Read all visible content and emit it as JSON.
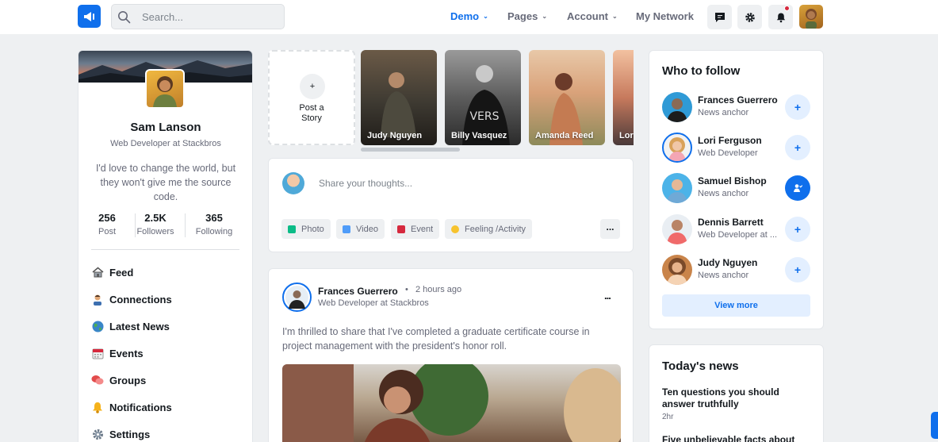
{
  "header": {
    "search_placeholder": "Search...",
    "nav": [
      "Demo",
      "Pages",
      "Account",
      "My Network"
    ]
  },
  "profile": {
    "name": "Sam Lanson",
    "title": "Web Developer at Stackbros",
    "bio": "I'd love to change the world, but they won't give me the source code.",
    "stats": [
      {
        "value": "256",
        "label": "Post"
      },
      {
        "value": "2.5K",
        "label": "Followers"
      },
      {
        "value": "365",
        "label": "Following"
      }
    ]
  },
  "menu": [
    {
      "label": "Feed",
      "icon": "home-icon"
    },
    {
      "label": "Connections",
      "icon": "person-icon"
    },
    {
      "label": "Latest News",
      "icon": "globe-icon"
    },
    {
      "label": "Events",
      "icon": "calendar-icon"
    },
    {
      "label": "Groups",
      "icon": "chat-icon"
    },
    {
      "label": "Notifications",
      "icon": "bell-icon"
    },
    {
      "label": "Settings",
      "icon": "gear-icon"
    }
  ],
  "stories": {
    "add_label_1": "Post a",
    "add_label_2": "Story",
    "items": [
      "Judy Nguyen",
      "Billy Vasquez",
      "Amanda Reed",
      "Lori"
    ]
  },
  "share": {
    "placeholder": "Share your thoughts...",
    "actions": [
      "Photo",
      "Video",
      "Event",
      "Feeling /Activity"
    ],
    "more": "..."
  },
  "post": {
    "author": "Frances Guerrero",
    "time": "2 hours ago",
    "role": "Web Developer at Stackbros",
    "text": "I'm thrilled to share that I've completed a graduate certificate course in project management with the president's honor roll.",
    "more": "..."
  },
  "who_to_follow": {
    "title": "Who to follow",
    "people": [
      {
        "name": "Frances Guerrero",
        "role": "News anchor"
      },
      {
        "name": "Lori Ferguson",
        "role": "Web Developer"
      },
      {
        "name": "Samuel Bishop",
        "role": "News anchor"
      },
      {
        "name": "Dennis Barrett",
        "role": "Web Developer at ..."
      },
      {
        "name": "Judy Nguyen",
        "role": "News anchor"
      }
    ],
    "view_more": "View more"
  },
  "news": {
    "title": "Today's news",
    "items": [
      {
        "headline": "Ten questions you should answer truthfully",
        "time": "2hr"
      },
      {
        "headline": "Five unbelievable facts about",
        "time": ""
      }
    ]
  },
  "colors": {
    "accent": "#0f6fec",
    "background": "#eef0f2",
    "alert": "#d6293e"
  }
}
